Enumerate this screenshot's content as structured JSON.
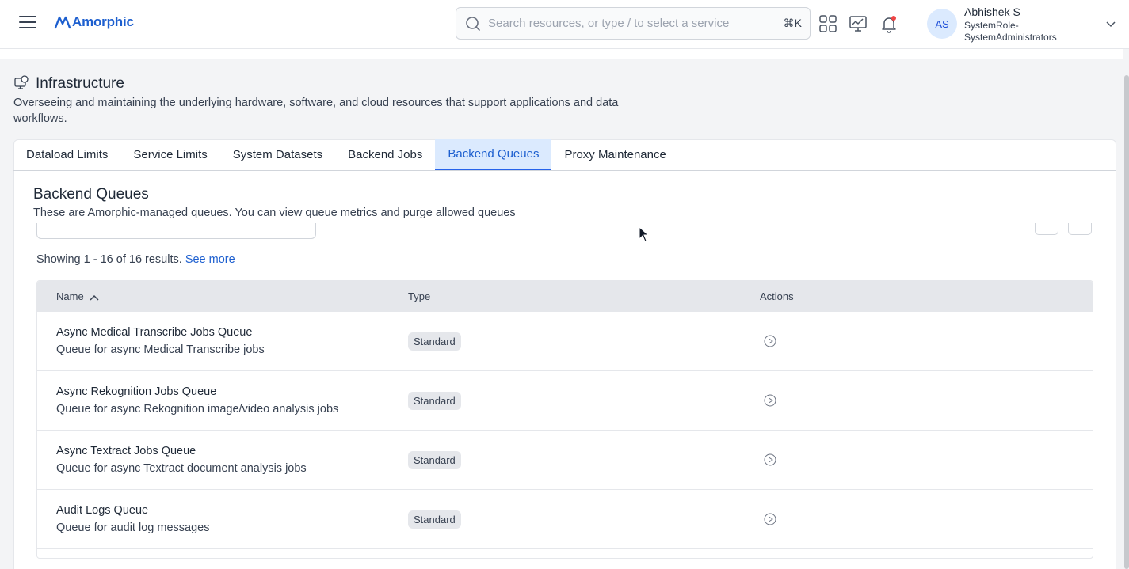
{
  "header": {
    "logo_text": "Amorphic",
    "search": {
      "placeholder": "Search resources, or type / to select a service",
      "shortcut": "⌘K"
    },
    "icons": [
      "grid-icon",
      "monitor-chart-icon",
      "bell-icon"
    ],
    "user": {
      "initials": "AS",
      "name": "Abhishek S",
      "role": "SystemRole-SystemAdministrators"
    }
  },
  "page": {
    "title": "Infrastructure",
    "description": "Overseeing and maintaining the underlying hardware, software, and cloud resources that support applications and data workflows."
  },
  "tabs": [
    {
      "label": "Dataload Limits",
      "active": false
    },
    {
      "label": "Service Limits",
      "active": false
    },
    {
      "label": "System Datasets",
      "active": false
    },
    {
      "label": "Backend Jobs",
      "active": false
    },
    {
      "label": "Backend Queues",
      "active": true
    },
    {
      "label": "Proxy Maintenance",
      "active": false
    }
  ],
  "section": {
    "title": "Backend Queues",
    "description": "These are Amorphic-managed queues. You can view queue metrics and purge allowed queues"
  },
  "results": {
    "showing": "Showing 1 - 16 of 16 results.",
    "see_more": "See more"
  },
  "table": {
    "columns": [
      "Name",
      "Type",
      "Actions"
    ],
    "rows": [
      {
        "name": "Async Medical Transcribe Jobs Queue",
        "description": "Queue for async Medical Transcribe jobs",
        "type": "Standard"
      },
      {
        "name": "Async Rekognition Jobs Queue",
        "description": "Queue for async Rekognition image/video analysis jobs",
        "type": "Standard"
      },
      {
        "name": "Async Textract Jobs Queue",
        "description": "Queue for async Textract document analysis jobs",
        "type": "Standard"
      },
      {
        "name": "Audit Logs Queue",
        "description": "Queue for audit log messages",
        "type": "Standard"
      }
    ]
  },
  "colors": {
    "accent": "#1d5fcf",
    "active_tab_bg": "#dbeafe",
    "header_bg": "#ffffff",
    "table_header_bg": "#e5e7eb"
  }
}
